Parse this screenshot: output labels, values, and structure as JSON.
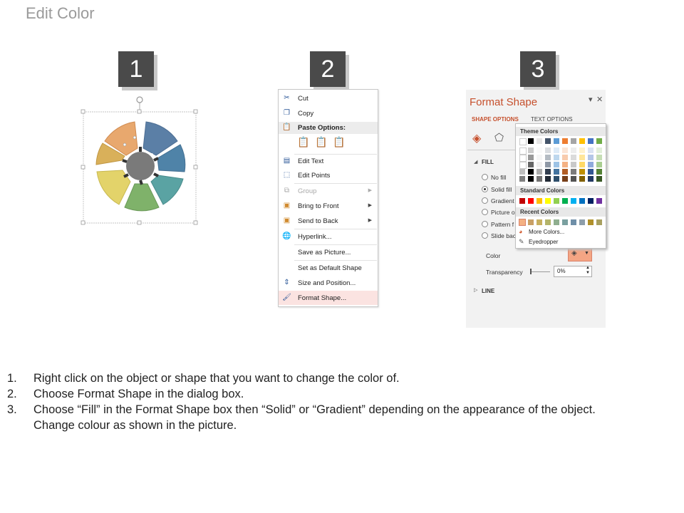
{
  "title": "Edit Color",
  "steps": [
    "1",
    "2",
    "3"
  ],
  "context_menu": {
    "items": [
      {
        "icon": "cut-icon",
        "label": "Cut"
      },
      {
        "icon": "copy-icon",
        "label": "Copy"
      },
      {
        "icon": "paste-icon",
        "label": "Paste Options:"
      },
      {
        "icon": "edit-text-icon",
        "label": "Edit Text"
      },
      {
        "icon": "edit-points-icon",
        "label": "Edit Points"
      },
      {
        "icon": "group-icon",
        "label": "Group"
      },
      {
        "icon": "bring-to-front-icon",
        "label": "Bring to Front"
      },
      {
        "icon": "send-to-back-icon",
        "label": "Send to Back"
      },
      {
        "icon": "hyperlink-icon",
        "label": "Hyperlink..."
      },
      {
        "icon": "",
        "label": "Save as Picture..."
      },
      {
        "icon": "",
        "label": "Set as Default Shape"
      },
      {
        "icon": "size-position-icon",
        "label": "Size and Position..."
      },
      {
        "icon": "format-shape-icon",
        "label": "Format Shape..."
      }
    ]
  },
  "format_pane": {
    "title": "Format Shape",
    "tab_shape": "SHAPE OPTIONS",
    "tab_text": "TEXT OPTIONS",
    "fill_label": "FILL",
    "options": [
      "No fill",
      "Solid fill",
      "Gradient",
      "Picture o",
      "Pattern f",
      "Slide bac"
    ],
    "color_label": "Color",
    "transparency_label": "Transparency",
    "transparency_value": "0%",
    "line_label": "LINE",
    "palette": {
      "theme_header": "Theme Colors",
      "standard_header": "Standard Colors",
      "recent_header": "Recent Colors",
      "more_colors": "More Colors...",
      "eyedropper": "Eyedropper",
      "theme_top": [
        "#ffffff",
        "#000000",
        "#e7e6e6",
        "#44546a",
        "#5b9bd5",
        "#ed7d31",
        "#a5a5a5",
        "#ffc000",
        "#4472c4",
        "#70ad47"
      ],
      "standard": [
        "#c00000",
        "#ff0000",
        "#ffc000",
        "#ffff00",
        "#92d050",
        "#00b050",
        "#00b0f0",
        "#0070c0",
        "#002060",
        "#7030a0"
      ],
      "recent": [
        "#f4b183",
        "#c9a066",
        "#c8b060",
        "#b4b46a",
        "#8fae8f",
        "#7aa0a0",
        "#6f8fa8",
        "#8e9eaa",
        "#b0902a",
        "#a8a060"
      ]
    }
  },
  "instructions": [
    {
      "n": "1.",
      "text": "Right click on the object or shape that you want to change the color of."
    },
    {
      "n": "2.",
      "text": "Choose Format Shape in the dialog box."
    },
    {
      "n": "3.",
      "text": "Choose “Fill” in the Format Shape box then “Solid” or “Gradient” depending on the appearance of the object."
    },
    {
      "n": "",
      "text": "Change colour as shown in the picture."
    }
  ]
}
